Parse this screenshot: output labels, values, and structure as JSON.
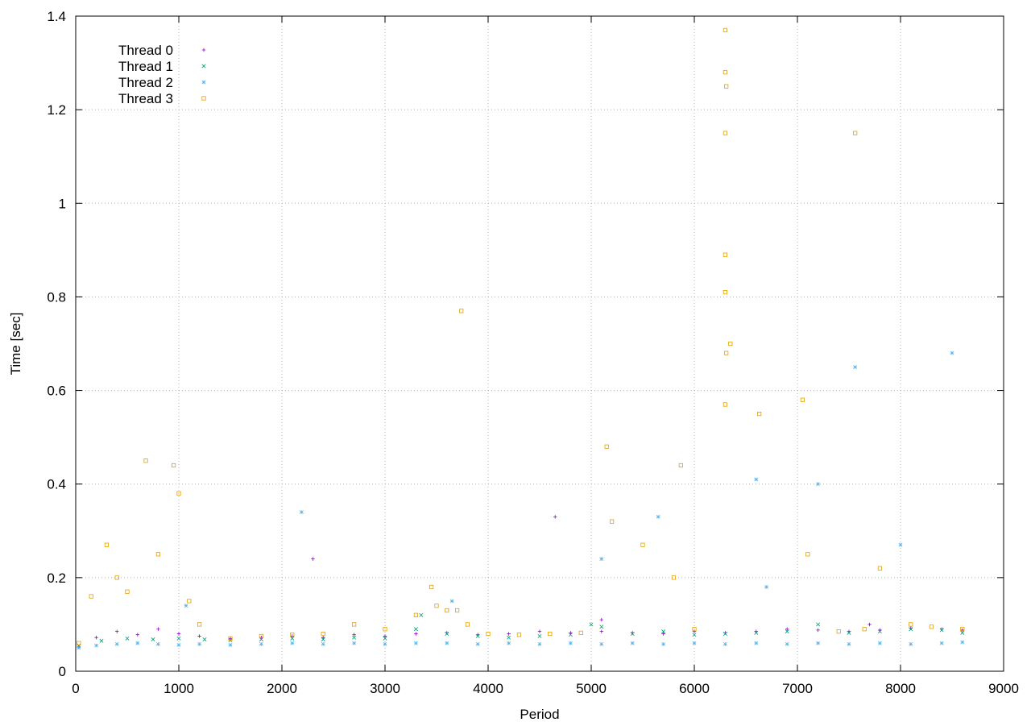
{
  "chart_data": {
    "type": "scatter",
    "title": "",
    "xlabel": "Period",
    "ylabel": "Time [sec]",
    "xlim": [
      0,
      9000
    ],
    "ylim": [
      0,
      1.4
    ],
    "x_ticks": [
      "0",
      "1000",
      "2000",
      "3000",
      "4000",
      "5000",
      "6000",
      "7000",
      "8000",
      "9000"
    ],
    "y_ticks": [
      "0",
      "0.2",
      "0.4",
      "0.6",
      "0.8",
      "1",
      "1.2",
      "1.4"
    ],
    "grid": true,
    "legend_position": "top-left",
    "series": [
      {
        "name": "Thread 0",
        "color": "#9400d3",
        "marker": "plus",
        "points": [
          [
            30,
            0.052
          ],
          [
            200,
            0.072
          ],
          [
            400,
            0.085
          ],
          [
            600,
            0.078
          ],
          [
            800,
            0.09
          ],
          [
            1000,
            0.08
          ],
          [
            1200,
            0.075
          ],
          [
            1500,
            0.07
          ],
          [
            1800,
            0.072
          ],
          [
            2100,
            0.075
          ],
          [
            2400,
            0.072
          ],
          [
            2700,
            0.078
          ],
          [
            3000,
            0.075
          ],
          [
            3300,
            0.08
          ],
          [
            3600,
            0.082
          ],
          [
            3900,
            0.078
          ],
          [
            4200,
            0.08
          ],
          [
            4500,
            0.085
          ],
          [
            4800,
            0.082
          ],
          [
            5100,
            0.085
          ],
          [
            5400,
            0.082
          ],
          [
            5700,
            0.08
          ],
          [
            6000,
            0.085
          ],
          [
            6300,
            0.082
          ],
          [
            6600,
            0.085
          ],
          [
            6900,
            0.09
          ],
          [
            7200,
            0.088
          ],
          [
            7500,
            0.085
          ],
          [
            7800,
            0.088
          ],
          [
            8100,
            0.092
          ],
          [
            8400,
            0.09
          ],
          [
            8600,
            0.088
          ],
          [
            5100,
            0.11
          ],
          [
            7700,
            0.1
          ],
          [
            2300,
            0.24
          ],
          [
            4650,
            0.33
          ]
        ]
      },
      {
        "name": "Thread 1",
        "color": "#009e73",
        "marker": "cross",
        "points": [
          [
            30,
            0.055
          ],
          [
            250,
            0.065
          ],
          [
            500,
            0.07
          ],
          [
            750,
            0.068
          ],
          [
            1000,
            0.07
          ],
          [
            1250,
            0.068
          ],
          [
            1500,
            0.066
          ],
          [
            1800,
            0.068
          ],
          [
            2100,
            0.07
          ],
          [
            2400,
            0.068
          ],
          [
            2700,
            0.072
          ],
          [
            3000,
            0.07
          ],
          [
            3300,
            0.09
          ],
          [
            3600,
            0.08
          ],
          [
            3900,
            0.075
          ],
          [
            4200,
            0.072
          ],
          [
            4500,
            0.075
          ],
          [
            4800,
            0.078
          ],
          [
            5100,
            0.095
          ],
          [
            5400,
            0.08
          ],
          [
            5700,
            0.085
          ],
          [
            6000,
            0.078
          ],
          [
            6300,
            0.08
          ],
          [
            6600,
            0.082
          ],
          [
            6900,
            0.085
          ],
          [
            7200,
            0.1
          ],
          [
            7500,
            0.082
          ],
          [
            7800,
            0.085
          ],
          [
            8100,
            0.09
          ],
          [
            8400,
            0.088
          ],
          [
            8600,
            0.082
          ],
          [
            5000,
            0.1
          ],
          [
            3350,
            0.12
          ]
        ]
      },
      {
        "name": "Thread 2",
        "color": "#56b4e9",
        "marker": "star",
        "points": [
          [
            30,
            0.05
          ],
          [
            200,
            0.055
          ],
          [
            400,
            0.058
          ],
          [
            600,
            0.06
          ],
          [
            800,
            0.058
          ],
          [
            1000,
            0.056
          ],
          [
            1200,
            0.058
          ],
          [
            1500,
            0.056
          ],
          [
            1800,
            0.058
          ],
          [
            2100,
            0.06
          ],
          [
            2400,
            0.058
          ],
          [
            2700,
            0.06
          ],
          [
            3000,
            0.058
          ],
          [
            3300,
            0.06
          ],
          [
            3600,
            0.06
          ],
          [
            3900,
            0.058
          ],
          [
            4200,
            0.06
          ],
          [
            4500,
            0.058
          ],
          [
            4800,
            0.06
          ],
          [
            5100,
            0.058
          ],
          [
            5400,
            0.06
          ],
          [
            5700,
            0.058
          ],
          [
            6000,
            0.06
          ],
          [
            6300,
            0.058
          ],
          [
            6600,
            0.06
          ],
          [
            6900,
            0.058
          ],
          [
            7200,
            0.06
          ],
          [
            7500,
            0.058
          ],
          [
            7800,
            0.06
          ],
          [
            8100,
            0.058
          ],
          [
            8400,
            0.06
          ],
          [
            8600,
            0.062
          ],
          [
            6600,
            0.41
          ],
          [
            7200,
            0.4
          ],
          [
            7560,
            0.65
          ],
          [
            8500,
            0.68
          ],
          [
            8000,
            0.27
          ],
          [
            6700,
            0.18
          ],
          [
            5650,
            0.33
          ],
          [
            5100,
            0.24
          ],
          [
            1070,
            0.14
          ],
          [
            2190,
            0.34
          ],
          [
            3650,
            0.15
          ]
        ]
      },
      {
        "name": "Thread 3",
        "color": "#e69f00",
        "marker": "box",
        "points": [
          [
            30,
            0.06
          ],
          [
            150,
            0.16
          ],
          [
            300,
            0.27
          ],
          [
            400,
            0.2
          ],
          [
            500,
            0.17
          ],
          [
            680,
            0.45
          ],
          [
            800,
            0.25
          ],
          [
            950,
            0.44
          ],
          [
            1000,
            0.38
          ],
          [
            1100,
            0.15
          ],
          [
            1200,
            0.1
          ],
          [
            1500,
            0.07
          ],
          [
            1800,
            0.075
          ],
          [
            2100,
            0.078
          ],
          [
            2400,
            0.08
          ],
          [
            2700,
            0.1
          ],
          [
            3000,
            0.09
          ],
          [
            3300,
            0.12
          ],
          [
            3450,
            0.18
          ],
          [
            3500,
            0.14
          ],
          [
            3600,
            0.13
          ],
          [
            3700,
            0.13
          ],
          [
            3800,
            0.1
          ],
          [
            4000,
            0.08
          ],
          [
            4300,
            0.078
          ],
          [
            4600,
            0.08
          ],
          [
            4900,
            0.082
          ],
          [
            5150,
            0.48
          ],
          [
            5200,
            0.32
          ],
          [
            5500,
            0.27
          ],
          [
            5800,
            0.2
          ],
          [
            5870,
            0.44
          ],
          [
            6000,
            0.09
          ],
          [
            6300,
            1.37
          ],
          [
            6300,
            1.28
          ],
          [
            6310,
            1.25
          ],
          [
            6300,
            1.15
          ],
          [
            6300,
            0.89
          ],
          [
            6300,
            0.81
          ],
          [
            6310,
            0.68
          ],
          [
            6300,
            0.57
          ],
          [
            6350,
            0.7
          ],
          [
            6630,
            0.55
          ],
          [
            7050,
            0.58
          ],
          [
            7100,
            0.25
          ],
          [
            7400,
            0.085
          ],
          [
            7560,
            1.15
          ],
          [
            7650,
            0.09
          ],
          [
            7800,
            0.22
          ],
          [
            8100,
            0.1
          ],
          [
            8300,
            0.095
          ],
          [
            8600,
            0.09
          ],
          [
            3740,
            0.77
          ]
        ]
      }
    ]
  }
}
